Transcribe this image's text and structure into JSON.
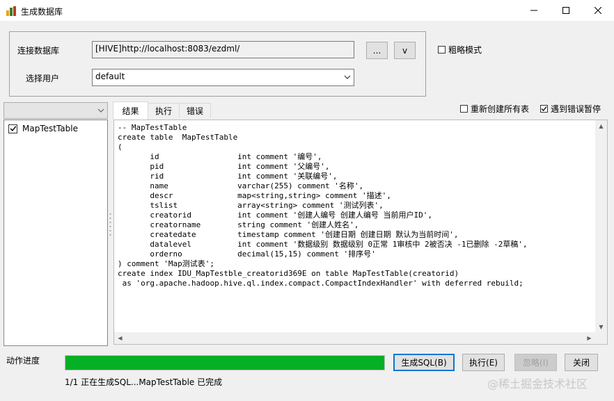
{
  "window": {
    "title": "生成数据库",
    "minimize": "—",
    "maximize": "☐",
    "close": "✕"
  },
  "connection": {
    "db_label": "连接数据库",
    "db_value": "[HIVE]http://localhost:8083/ezdml/",
    "browse_label": "...",
    "dropdown_label": "v",
    "user_label": "选择用户",
    "user_value": "default",
    "rough_mode_label": "粗略模式"
  },
  "options": {
    "recreate_all_label": "重新创建所有表",
    "recreate_all_checked": false,
    "pause_on_error_label": "遇到错误暂停",
    "pause_on_error_checked": true
  },
  "tables": {
    "items": [
      {
        "label": "MapTestTable",
        "checked": true
      }
    ]
  },
  "tabs": [
    {
      "label": "结果",
      "active": true
    },
    {
      "label": "执行",
      "active": false
    },
    {
      "label": "错误",
      "active": false
    }
  ],
  "sql_output": "-- MapTestTable\ncreate table  MapTestTable\n(\n       id                 int comment '编号',\n       pid                int comment '父编号',\n       rid                int comment '关联编号',\n       name               varchar(255) comment '名称',\n       descr              map<string,string> comment '描述',\n       tslist             array<string> comment '测试列表',\n       creatorid          int comment '创建人编号 创建人编号 当前用户ID',\n       creatorname        string comment '创建人姓名',\n       createdate         timestamp comment '创建日期 创建日期 默认为当前时间',\n       datalevel          int comment '数据级别 数据级别 0正常 1审核中 2被否决 -1已删除 -2草稿',\n       orderno            decimal(15,15) comment '排序号'\n) comment 'Map测试表';\ncreate index IDU_MapTestble_creatorid369E on table MapTestTable(creatorid)\n as 'org.apache.hadoop.hive.ql.index.compact.CompactIndexHandler' with deferred rebuild;",
  "progress": {
    "label": "动作进度",
    "percent": 100,
    "fill_color": "#06b025",
    "status_text": "1/1 正在生成SQL...MapTestTable 已完成"
  },
  "buttons": {
    "generate_sql": "生成SQL(B)",
    "execute": "执行(E)",
    "ignore": "忽略(I)",
    "close": "关闭"
  },
  "watermark": "@稀土掘金技术社区"
}
